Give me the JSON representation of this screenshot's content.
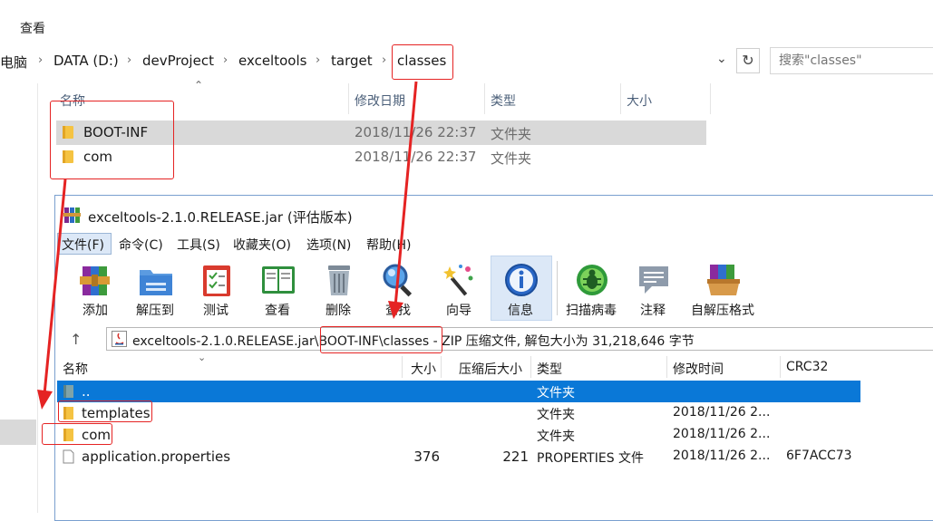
{
  "explorer": {
    "ribbon_tab": "查看",
    "breadcrumbs": [
      "电脑",
      "DATA (D:)",
      "devProject",
      "exceltools",
      "target",
      "classes"
    ],
    "search_placeholder": "搜索\"classes\"",
    "columns": {
      "name": "名称",
      "date": "修改日期",
      "type": "类型",
      "size": "大小"
    },
    "rows": [
      {
        "name": "BOOT-INF",
        "date": "2018/11/26 22:37",
        "type": "文件夹",
        "selected": true
      },
      {
        "name": "com",
        "date": "2018/11/26 22:37",
        "type": "文件夹",
        "selected": false
      }
    ]
  },
  "winrar": {
    "title": "exceltools-2.1.0.RELEASE.jar (评估版本)",
    "menu": [
      "文件(F)",
      "命令(C)",
      "工具(S)",
      "收藏夹(O)",
      "选项(N)",
      "帮助(H)"
    ],
    "toolbar": [
      {
        "label": "添加",
        "icon": "add-archive-icon"
      },
      {
        "label": "解压到",
        "icon": "extract-to-icon"
      },
      {
        "label": "测试",
        "icon": "test-icon"
      },
      {
        "label": "查看",
        "icon": "view-book-icon"
      },
      {
        "label": "删除",
        "icon": "delete-trash-icon"
      },
      {
        "label": "查找",
        "icon": "find-magnifier-icon"
      },
      {
        "label": "向导",
        "icon": "wizard-wand-icon"
      },
      {
        "label": "信息",
        "icon": "info-icon"
      },
      {
        "label": "扫描病毒",
        "icon": "virus-scan-icon"
      },
      {
        "label": "注释",
        "icon": "comment-icon"
      },
      {
        "label": "自解压格式",
        "icon": "sfx-icon"
      }
    ],
    "path_text": "exceltools-2.1.0.RELEASE.jar\\BOOT-INF\\classes - ZIP 压缩文件, 解包大小为 31,218,646 字节",
    "columns": {
      "name": "名称",
      "size": "大小",
      "packed": "压缩后大小",
      "type": "类型",
      "modified": "修改时间",
      "crc": "CRC32"
    },
    "rows": [
      {
        "name": "..",
        "size": "",
        "packed": "",
        "type": "文件夹",
        "modified": "",
        "crc": "",
        "kind": "up",
        "selected": true
      },
      {
        "name": "templates",
        "size": "",
        "packed": "",
        "type": "文件夹",
        "modified": "2018/11/26 2...",
        "crc": "",
        "kind": "folder",
        "selected": false
      },
      {
        "name": "com",
        "size": "",
        "packed": "",
        "type": "文件夹",
        "modified": "2018/11/26 2...",
        "crc": "",
        "kind": "folder",
        "selected": false
      },
      {
        "name": "application.properties",
        "size": "376",
        "packed": "221",
        "type": "PROPERTIES 文件",
        "modified": "2018/11/26 2...",
        "crc": "6F7ACC73",
        "kind": "file",
        "selected": false
      }
    ]
  },
  "colors": {
    "annotation_red": "#e52323",
    "selection_blue": "#0a78d7",
    "folder_yellow": "#f5c342"
  }
}
